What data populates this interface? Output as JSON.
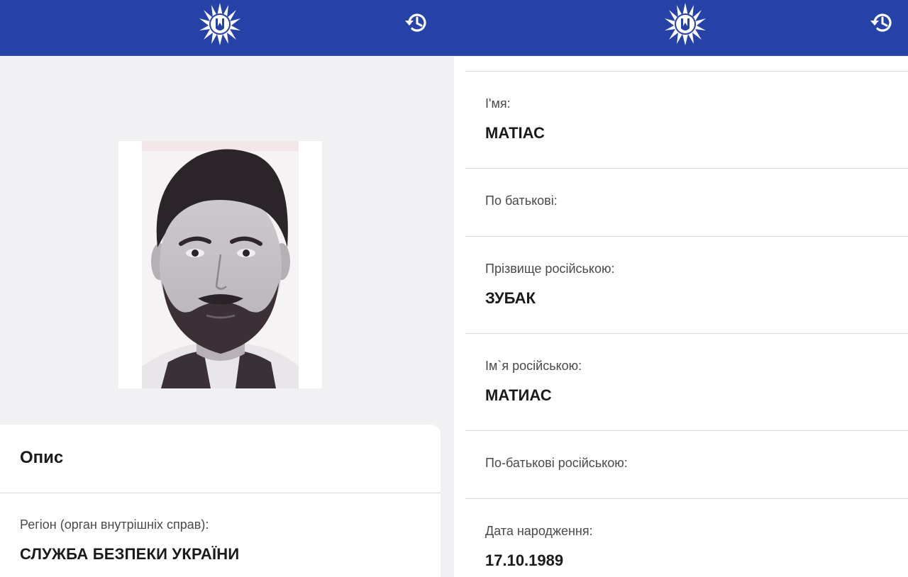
{
  "app": {
    "emblem_icon": "police-emblem-icon",
    "history_icon": "history-icon",
    "header_color": "#2742a6"
  },
  "left_screen": {
    "photo": "person-photo",
    "description_card": {
      "title": "Опис",
      "region_label": "Регіон (орган внутрішніх справ):",
      "region_value": "СЛУЖБА БЕЗПЕКИ УКРАЇНИ"
    }
  },
  "right_screen": {
    "fields": [
      {
        "label": "І'мя:",
        "value": "МАТІАС"
      },
      {
        "label": "По батькові:",
        "value": ""
      },
      {
        "label": "Прізвище російською:",
        "value": "ЗУБАК"
      },
      {
        "label": "Ім`я російською:",
        "value": "МАТИАС"
      },
      {
        "label": "По-батькові російською:",
        "value": ""
      },
      {
        "label": "Дата народження:",
        "value": "17.10.1989"
      }
    ]
  }
}
